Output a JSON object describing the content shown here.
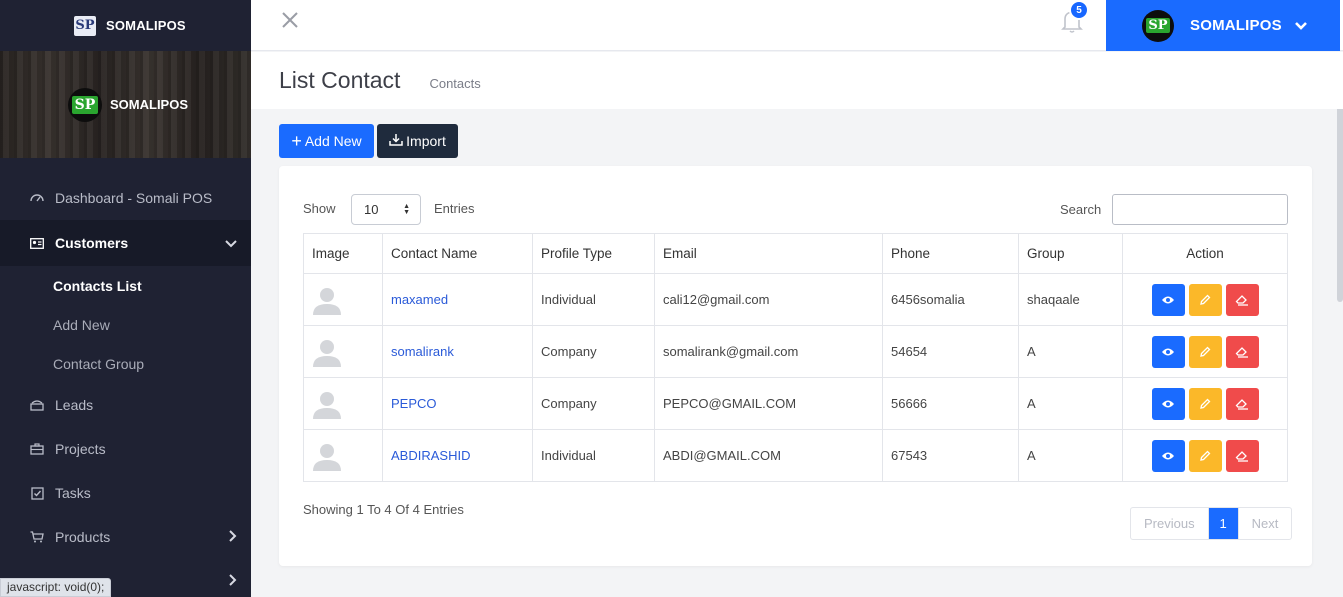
{
  "app": {
    "brand": "SOMALIPOS",
    "logo_text": "SP"
  },
  "sidebar": {
    "items": [
      {
        "label": "Dashboard - Somali POS",
        "icon": "dashboard-icon"
      },
      {
        "label": "Customers",
        "icon": "contact-card-icon"
      },
      {
        "label": "Leads",
        "icon": "leads-icon"
      },
      {
        "label": "Projects",
        "icon": "briefcase-icon"
      },
      {
        "label": "Tasks",
        "icon": "checkbox-icon"
      },
      {
        "label": "Products",
        "icon": "cart-icon"
      }
    ],
    "customers_sub": [
      "Contacts List",
      "Add New",
      "Contact Group"
    ]
  },
  "status_bar": {
    "text": "javascript: void(0);"
  },
  "header": {
    "notifications_count": "5",
    "user_name": "SOMALIPOS"
  },
  "page": {
    "title": "List Contact",
    "breadcrumb": "Contacts"
  },
  "toolbar": {
    "add_label": "Add New",
    "import_label": "Import"
  },
  "table_controls": {
    "show_label": "Show",
    "entries_value": "10",
    "entries_label": "Entries",
    "search_label": "Search",
    "search_value": ""
  },
  "table": {
    "headers": [
      "Image",
      "Contact Name",
      "Profile Type",
      "Email",
      "Phone",
      "Group",
      "Action"
    ],
    "rows": [
      {
        "name": "maxamed",
        "type": "Individual",
        "email": "cali12@gmail.com",
        "phone": "6456somalia",
        "group": "shaqaale"
      },
      {
        "name": "somalirank",
        "type": "Company",
        "email": "somalirank@gmail.com",
        "phone": "54654",
        "group": "A"
      },
      {
        "name": "PEPCO",
        "type": "Company",
        "email": "PEPCO@GMAIL.COM",
        "phone": "56666",
        "group": "A"
      },
      {
        "name": "ABDIRASHID",
        "type": "Individual",
        "email": "ABDI@GMAIL.COM",
        "phone": "67543",
        "group": "A"
      }
    ]
  },
  "footer": {
    "showing_text": "Showing 1 To 4 Of 4 Entries",
    "prev_label": "Previous",
    "current_page": "1",
    "next_label": "Next"
  },
  "colors": {
    "primary": "#1a6bff",
    "sidebar": "#1f2233",
    "warning": "#fbb829",
    "danger": "#f04b4b"
  }
}
